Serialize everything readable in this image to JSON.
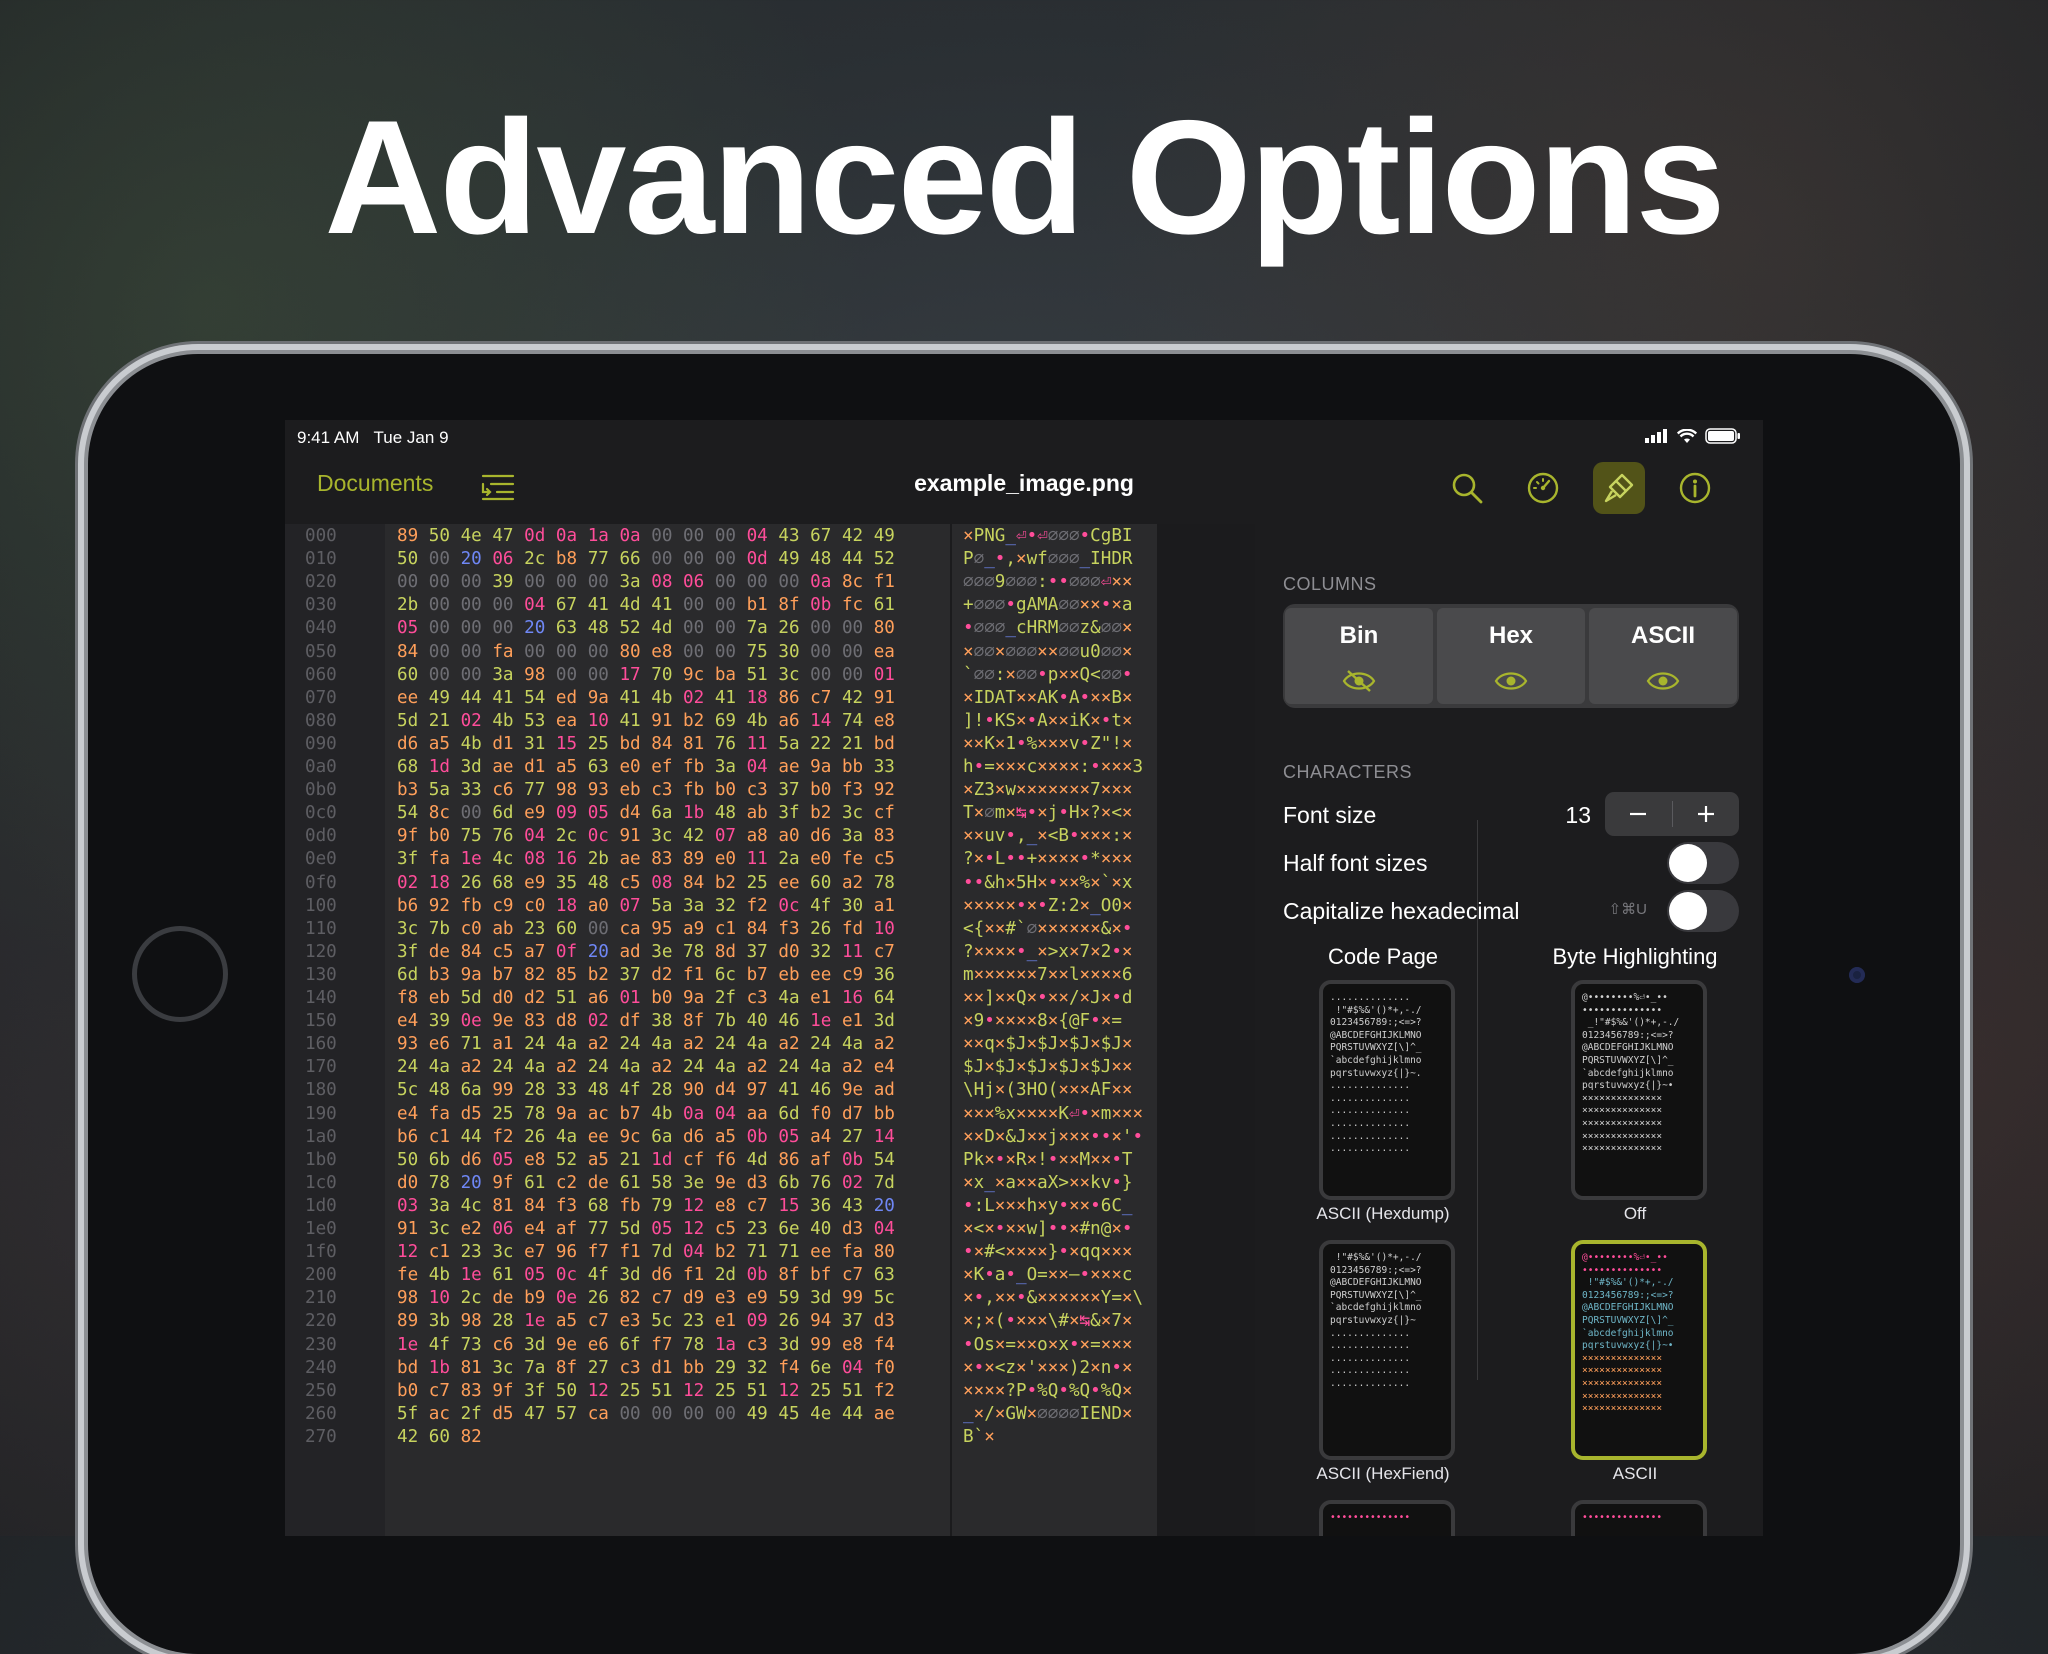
{
  "headline": "Advanced Options",
  "status": {
    "time": "9:41 AM",
    "date": "Tue Jan 9"
  },
  "nav": {
    "back_label": "Documents",
    "title": "example_image.png"
  },
  "hex_rows": [
    {
      "o": "000",
      "h": "89 50 4e 47 0d 0a 1a 0a 00 00 00 04 43 67 42 49",
      "a": "×PNG_⏎•⏎∅∅∅•CgBI"
    },
    {
      "o": "010",
      "h": "50 00 20 06 2c b8 77 66 00 00 00 0d 49 48 44 52",
      "a": "P∅_•,×wf∅∅∅_IHDR"
    },
    {
      "o": "020",
      "h": "00 00 00 39 00 00 00 3a 08 06 00 00 00 0a 8c f1",
      "a": "∅∅∅9∅∅∅:••∅∅∅⏎××"
    },
    {
      "o": "030",
      "h": "2b 00 00 00 04 67 41 4d 41 00 00 b1 8f 0b fc 61",
      "a": "+∅∅∅•gAMA∅∅××•×a"
    },
    {
      "o": "040",
      "h": "05 00 00 00 20 63 48 52 4d 00 00 7a 26 00 00 80",
      "a": "•∅∅∅_cHRM∅∅z&∅∅×"
    },
    {
      "o": "050",
      "h": "84 00 00 fa 00 00 00 80 e8 00 00 75 30 00 00 ea",
      "a": "×∅∅×∅∅∅××∅∅u0∅∅×"
    },
    {
      "o": "060",
      "h": "60 00 00 3a 98 00 00 17 70 9c ba 51 3c 00 00 01",
      "a": "`∅∅:×∅∅•p××Q<∅∅•"
    },
    {
      "o": "070",
      "h": "ee 49 44 41 54 ed 9a 41 4b 02 41 18 86 c7 42 91",
      "a": "×IDAT××AK•A•××B×"
    },
    {
      "o": "080",
      "h": "5d 21 02 4b 53 ea 10 41 91 b2 69 4b a6 14 74 e8",
      "a": "]!•KS×•A××iK×•t×"
    },
    {
      "o": "090",
      "h": "d6 a5 4b d1 31 15 25 bd 84 81 76 11 5a 22 21 bd",
      "a": "××K×1•%×××v•Z\"!×"
    },
    {
      "o": "0a0",
      "h": "68 1d 3d ae d1 a5 63 e0 ef fb 3a 04 ae 9a bb 33",
      "a": "h•=×××c××××:•×××3"
    },
    {
      "o": "0b0",
      "h": "b3 5a 33 c6 77 98 93 eb c3 fb b0 c3 37 b0 f3 92",
      "a": "×Z3×w×××××××7×××"
    },
    {
      "o": "0c0",
      "h": "54 8c 00 6d e9 09 05 d4 6a 1b 48 ab 3f b2 3c cf",
      "a": "T×∅m×↹•×j•H×?×<×"
    },
    {
      "o": "0d0",
      "h": "9f b0 75 76 04 2c 0c 91 3c 42 07 a8 a0 d6 3a 83",
      "a": "××uv•,_×<B•×××:×"
    },
    {
      "o": "0e0",
      "h": "3f fa 1e 4c 08 16 2b ae 83 89 e0 11 2a e0 fe c5",
      "a": "?×•L••+××××•*×××"
    },
    {
      "o": "0f0",
      "h": "02 18 26 68 e9 35 48 c5 08 84 b2 25 ee 60 a2 78",
      "a": "••&h×5H×•××%×`×x"
    },
    {
      "o": "100",
      "h": "b6 92 fb c9 c0 18 a0 07 5a 3a 32 f2 0c 4f 30 a1",
      "a": "×××××•×•Z:2×_O0×"
    },
    {
      "o": "110",
      "h": "3c 7b c0 ab 23 60 00 ca 95 a9 c1 84 f3 26 fd 10",
      "a": "<{××#`∅××××××&×•"
    },
    {
      "o": "120",
      "h": "3f de 84 c5 a7 0f 20 ad 3e 78 8d 37 d0 32 11 c7",
      "a": "?××××•_×>x×7×2•×"
    },
    {
      "o": "130",
      "h": "6d b3 9a b7 82 85 b2 37 d2 f1 6c b7 eb ee c9 36",
      "a": "m××××××7××l××××6"
    },
    {
      "o": "140",
      "h": "f8 eb 5d d0 d2 51 a6 01 b0 9a 2f c3 4a e1 16 64",
      "a": "××]××Q×•××/×J×•d"
    },
    {
      "o": "150",
      "h": "e4 39 0e 9e 83 d8 02 df 38 8f 7b 40 46 1e e1 3d",
      "a": "×9•××××8×{@F•×="
    },
    {
      "o": "160",
      "h": "93 e6 71 a1 24 4a a2 24 4a a2 24 4a a2 24 4a a2",
      "a": "××q×$J×$J×$J×$J×"
    },
    {
      "o": "170",
      "h": "24 4a a2 24 4a a2 24 4a a2 24 4a a2 24 4a a2 e4",
      "a": "$J×$J×$J×$J×$J××"
    },
    {
      "o": "180",
      "h": "5c 48 6a 99 28 33 48 4f 28 90 d4 97 41 46 9e ad",
      "a": "\\Hj×(3HO(×××AF××"
    },
    {
      "o": "190",
      "h": "e4 fa d5 25 78 9a ac b7 4b 0a 04 aa 6d f0 d7 bb",
      "a": "×××%x××××K⏎•×m×××"
    },
    {
      "o": "1a0",
      "h": "b6 c1 44 f2 26 4a ee 9c 6a d6 a5 0b 05 a4 27 14",
      "a": "××D×&J××j×××••×'•"
    },
    {
      "o": "1b0",
      "h": "50 6b d6 05 e8 52 a5 21 1d cf f6 4d 86 af 0b 54",
      "a": "Pk×•×R×!•××M××•T"
    },
    {
      "o": "1c0",
      "h": "d0 78 20 9f 61 c2 de 61 58 3e 9e d3 6b 76 02 7d",
      "a": "×x_×a××aX>××kv•}"
    },
    {
      "o": "1d0",
      "h": "03 3a 4c 81 84 f3 68 fb 79 12 e8 c7 15 36 43 20",
      "a": "•:L×××h×y•××•6C_"
    },
    {
      "o": "1e0",
      "h": "91 3c e2 06 e4 af 77 5d 05 12 c5 23 6e 40 d3 04",
      "a": "×<×•××w]••×#n@×•"
    },
    {
      "o": "1f0",
      "h": "12 c1 23 3c e7 96 f7 f1 7d 04 b2 71 71 ee fa 80",
      "a": "•×#<××××}•×qq×××"
    },
    {
      "o": "200",
      "h": "fe 4b 1e 61 05 0c 4f 3d d6 f1 2d 0b 8f bf c7 63",
      "a": "×K•a•_O=××–•×××c"
    },
    {
      "o": "210",
      "h": "98 10 2c de b9 0e 26 82 c7 d9 e3 e9 59 3d 99 5c",
      "a": "×•,××•&××××××Y=×\\"
    },
    {
      "o": "220",
      "h": "89 3b 98 28 1e a5 c7 e3 5c 23 e1 09 26 94 37 d3",
      "a": "×;×(•×××\\#×↹&×7×"
    },
    {
      "o": "230",
      "h": "1e 4f 73 c6 3d 9e e6 6f f7 78 1a c3 3d 99 e8 f4",
      "a": "•Os×=××o×x•×=×××"
    },
    {
      "o": "240",
      "h": "bd 1b 81 3c 7a 8f 27 c3 d1 bb 29 32 f4 6e 04 f0",
      "a": "×•×<z×'×××)2×n•×"
    },
    {
      "o": "250",
      "h": "b0 c7 83 9f 3f 50 12 25 51 12 25 51 12 25 51 f2",
      "a": "××××?P•%Q•%Q•%Q×"
    },
    {
      "o": "260",
      "h": "5f ac 2f d5 47 57 ca 00 00 00 00 49 45 4e 44 ae",
      "a": "_×/×GW×∅∅∅∅IEND×"
    },
    {
      "o": "270",
      "h": "42 60 82",
      "a": "B`×"
    }
  ],
  "panel": {
    "columns_title": "COLUMNS",
    "columns": [
      {
        "label": "Bin",
        "icon": "eye-slash-icon",
        "visible": false
      },
      {
        "label": "Hex",
        "icon": "eye-icon",
        "visible": true
      },
      {
        "label": "ASCII",
        "icon": "eye-icon",
        "visible": true
      }
    ],
    "characters_title": "CHARACTERS",
    "font_size_label": "Font size",
    "font_size_value": "13",
    "half_font_label": "Half font sizes",
    "capitalize_label": "Capitalize hexadecimal",
    "capitalize_shortcut": "⇧⌘U",
    "code_page_title": "Code Page",
    "byte_highlight_title": "Byte Highlighting",
    "code_pages": [
      {
        "label": "ASCII (Hexdump)",
        "selected": false
      },
      {
        "label": "ASCII (HexFiend)",
        "selected": false
      }
    ],
    "highlights": [
      {
        "label": "Off",
        "selected": false
      },
      {
        "label": "ASCII",
        "selected": true
      }
    ]
  },
  "colors": {
    "accent": "#a8b52d",
    "zero": "#6e6e74",
    "blue": "#6f87f5",
    "pink": "#ff4d9a",
    "orange": "#ff9f5a"
  }
}
